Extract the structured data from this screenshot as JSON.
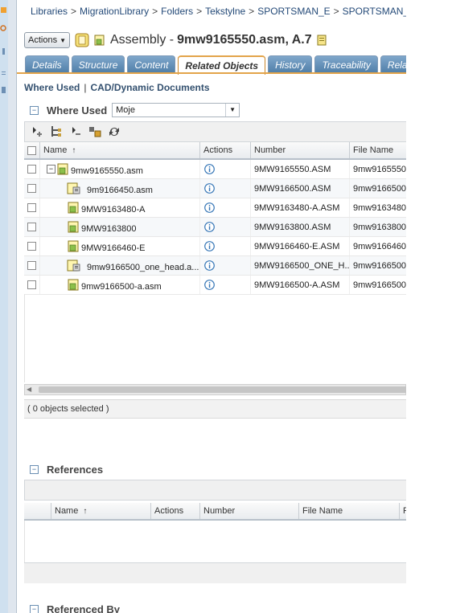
{
  "breadcrumb": {
    "home_icon": "home-icon",
    "items": [
      "Libraries",
      "MigrationLibrary",
      "Folders",
      "Tekstylne",
      "SPORTSMAN_E",
      "SPORTSMAN_"
    ],
    "separator": ">"
  },
  "header": {
    "actions_label": "Actions",
    "object_type": "Assembly -",
    "object_name": "9mw9165550.asm, A.7"
  },
  "tabs": [
    {
      "label": "Details",
      "active": false
    },
    {
      "label": "Structure",
      "active": false
    },
    {
      "label": "Content",
      "active": false
    },
    {
      "label": "Related Objects",
      "active": true
    },
    {
      "label": "History",
      "active": false
    },
    {
      "label": "Traceability",
      "active": false
    },
    {
      "label": "Relat",
      "active": false
    }
  ],
  "subnav": {
    "where_used": "Where Used",
    "separator": "|",
    "cad_docs": "CAD/Dynamic Documents"
  },
  "where_used": {
    "title": "Where Used",
    "view_value": "Moje",
    "columns": [
      "Name",
      "Actions",
      "Number",
      "File Name"
    ],
    "rows": [
      {
        "name": "9mw9165550.asm",
        "number": "9MW9165550.ASM",
        "file": "9mw9165550",
        "level": 0,
        "icon": "assembly",
        "expand": true
      },
      {
        "name": "9m9166450.asm",
        "number": "9MW9166500.ASM",
        "file": "9mw9166500",
        "level": 2,
        "icon": "assembly"
      },
      {
        "name": "9MW9163480-A",
        "number": "9MW9163480-A.ASM",
        "file": "9mw9163480",
        "level": 1,
        "icon": "part"
      },
      {
        "name": "9MW9163800",
        "number": "9MW9163800.ASM",
        "file": "9mw9163800",
        "level": 1,
        "icon": "part"
      },
      {
        "name": "9MW9166460-E",
        "number": "9MW9166460-E.ASM",
        "file": "9mw9166460",
        "level": 1,
        "icon": "part"
      },
      {
        "name": "9mw9166500_one_head.a...",
        "number": "9MW9166500_ONE_H...",
        "file": "9mw9166500",
        "level": 2,
        "icon": "assembly"
      },
      {
        "name": "9mw9166500-a.asm",
        "number": "9MW9166500-A.ASM",
        "file": "9mw9166500",
        "level": 1,
        "icon": "part"
      }
    ],
    "status": "( 0 objects selected )"
  },
  "references": {
    "title": "References",
    "columns": [
      "Name",
      "Actions",
      "Number",
      "File Name",
      "R"
    ]
  },
  "referenced_by": {
    "title": "Referenced By"
  },
  "colors": {
    "tab_active_border": "#e3a44a",
    "tab_bg": "#4f7ea8",
    "link": "#244a78"
  }
}
